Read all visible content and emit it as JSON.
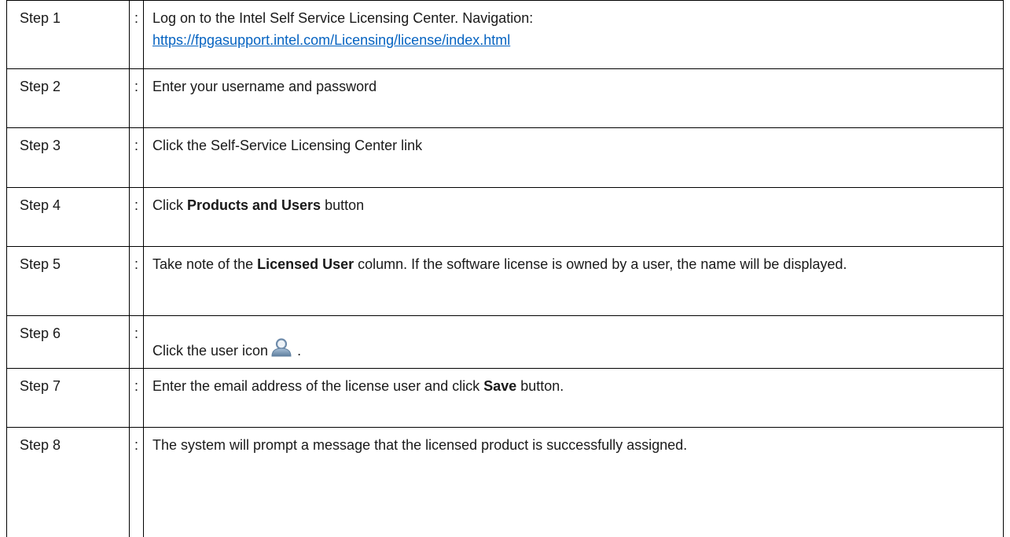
{
  "steps": [
    {
      "label": "Step 1",
      "sep": ":",
      "text_before": "Log on to the Intel Self Service Licensing Center. Navigation:",
      "link": "https://fpgasupport.intel.com/Licensing/license/index.html"
    },
    {
      "label": "Step 2",
      "sep": ":",
      "text": "Enter your username and password"
    },
    {
      "label": "Step 3",
      "sep": ":",
      "text": "Click the Self-Service Licensing Center link"
    },
    {
      "label": "Step 4",
      "sep": ":",
      "text_before": "Click ",
      "bold": "Products and Users",
      "text_after": " button"
    },
    {
      "label": "Step 5",
      "sep": ":",
      "text_before": "Take note of the ",
      "bold": "Licensed User",
      "text_after": " column. If the software license is owned by a user, the name will be displayed."
    },
    {
      "label": "Step 6",
      "sep": ":",
      "text_before": "Click the user icon",
      "icon": "user-icon",
      "text_after": "."
    },
    {
      "label": "Step 7",
      "sep": ":",
      "text_before": "Enter the email address of the license user and click ",
      "bold": "Save",
      "text_after": " button."
    },
    {
      "label": "Step 8",
      "sep": ":",
      "text": "The system will prompt a message that the licensed product is successfully assigned."
    }
  ],
  "colors": {
    "link": "#0563c1",
    "icon_fill": "#7f9bb8"
  }
}
